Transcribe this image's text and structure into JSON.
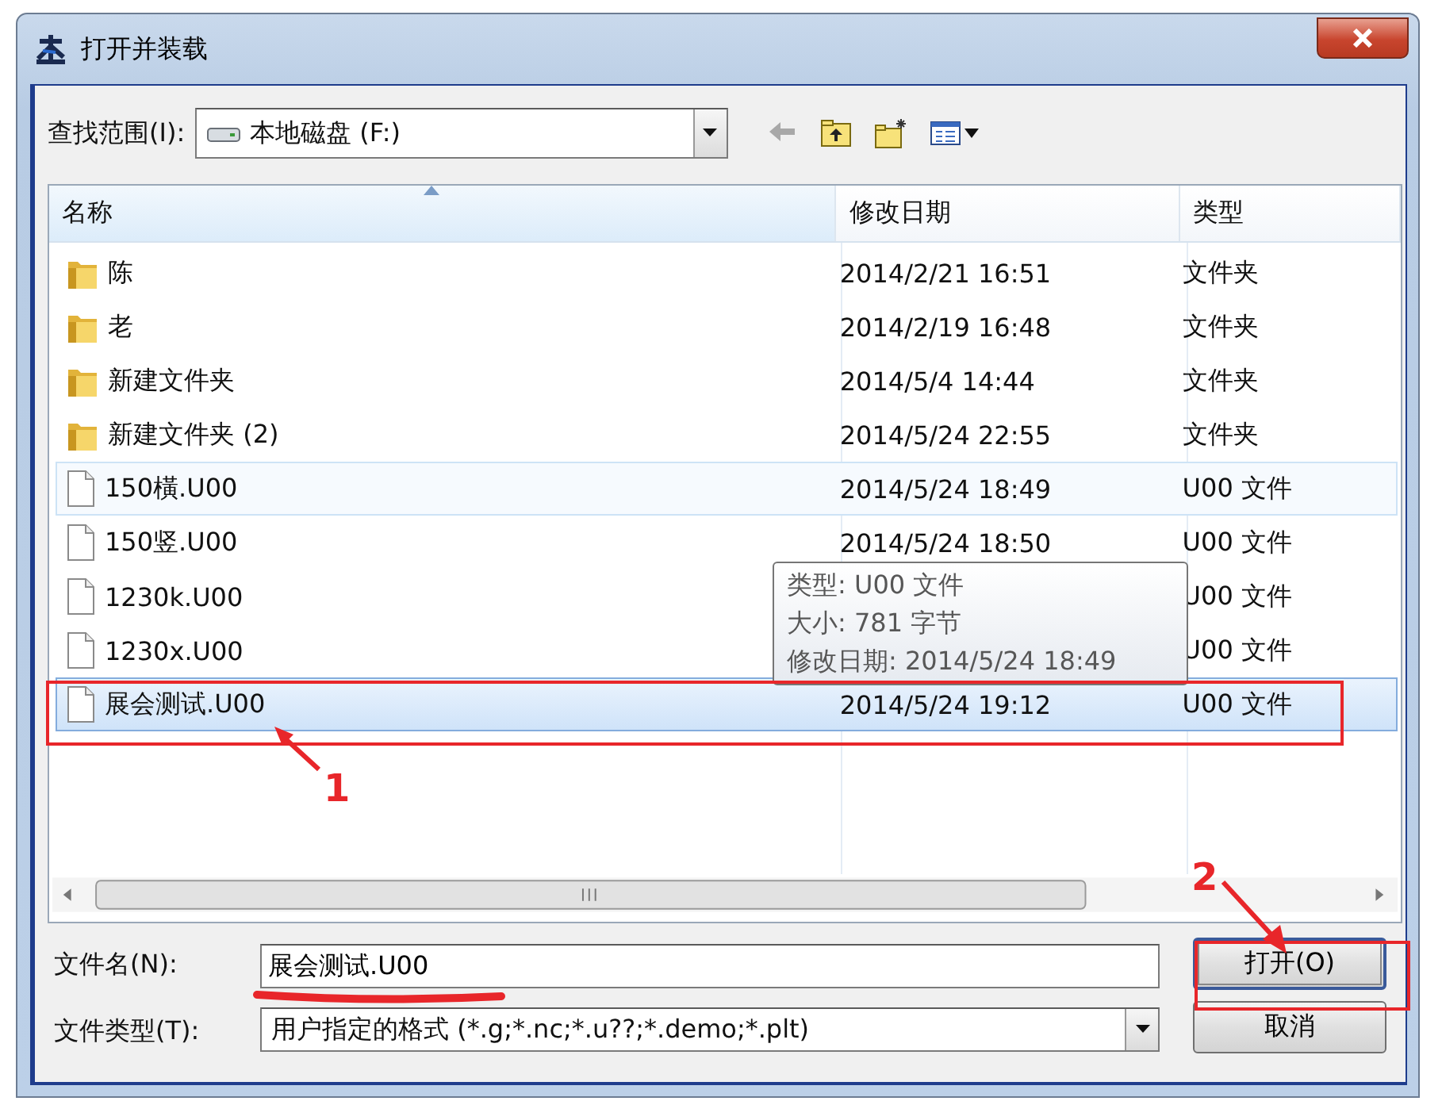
{
  "window": {
    "title": "打开并装载"
  },
  "look_in": {
    "label": "查找范围(I):",
    "value": "本地磁盘 (F:)"
  },
  "toolbar": [
    {
      "kind": "back",
      "disabled": true
    },
    {
      "kind": "up",
      "disabled": false
    },
    {
      "kind": "new_folder",
      "disabled": false
    },
    {
      "kind": "view_menu",
      "disabled": false
    }
  ],
  "file_list": {
    "columns": [
      {
        "label": "名称",
        "sorted": true
      },
      {
        "label": "修改日期",
        "sorted": false
      },
      {
        "label": "类型",
        "sorted": false
      }
    ],
    "rows": [
      {
        "kind": "folder",
        "name": "陈",
        "modified": "2014/2/21 16:51",
        "type": "文件夹",
        "selected": false,
        "hovered": false
      },
      {
        "kind": "folder",
        "name": "老",
        "modified": "2014/2/19 16:48",
        "type": "文件夹",
        "selected": false,
        "hovered": false
      },
      {
        "kind": "folder",
        "name": "新建文件夹",
        "modified": "2014/5/4 14:44",
        "type": "文件夹",
        "selected": false,
        "hovered": false
      },
      {
        "kind": "folder",
        "name": "新建文件夹 (2)",
        "modified": "2014/5/24 22:55",
        "type": "文件夹",
        "selected": false,
        "hovered": false
      },
      {
        "kind": "file",
        "name": "150橫.U00",
        "modified": "2014/5/24 18:49",
        "type": "U00 文件",
        "selected": false,
        "hovered": true
      },
      {
        "kind": "file",
        "name": "150竖.U00",
        "modified": "2014/5/24 18:50",
        "type": "U00 文件",
        "selected": false,
        "hovered": false
      },
      {
        "kind": "file",
        "name": "1230k.U00",
        "type": "U00 文件",
        "selected": false,
        "hovered": false
      },
      {
        "kind": "file",
        "name": "1230x.U00",
        "type": "U00 文件",
        "selected": false,
        "hovered": false
      },
      {
        "kind": "file",
        "name": "展会测试.U00",
        "modified": "2014/5/24 19:12",
        "type": "U00 文件",
        "selected": true,
        "hovered": false
      }
    ],
    "tooltip": [
      "类型: U00 文件",
      "大小: 781 字节",
      "修改日期: 2014/5/24 18:49"
    ]
  },
  "file_name": {
    "label": "文件名(N):",
    "value": "展会测试.U00",
    "underlined": true
  },
  "file_type": {
    "label": "文件类型(T):",
    "value": "用户指定的格式 (*.g;*.nc;*.u??;*.demo;*.plt)"
  },
  "buttons": [
    {
      "label": "打开(O)",
      "default": true
    },
    {
      "label": "取消",
      "default": false
    }
  ],
  "steps": [
    {
      "label": "1"
    },
    {
      "label": "2"
    }
  ]
}
